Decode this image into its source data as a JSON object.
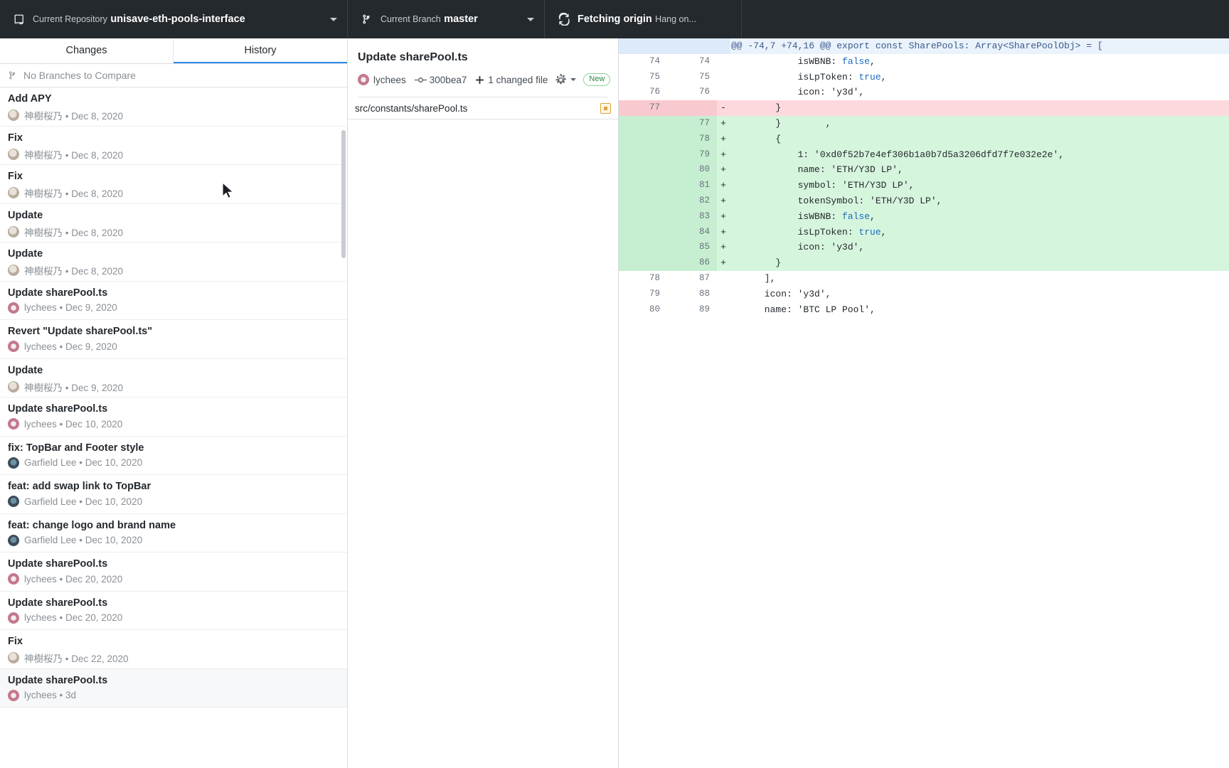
{
  "toolbar": {
    "repository": {
      "label": "Current Repository",
      "value": "unisave-eth-pools-interface",
      "icon": "repo-icon"
    },
    "branch": {
      "label": "Current Branch",
      "value": "master",
      "icon": "branch-icon"
    },
    "push": {
      "label": "Fetching origin",
      "value": "Hang on...",
      "icon": "sync-icon"
    }
  },
  "sidebar": {
    "tabs": [
      {
        "label": "Changes",
        "active": false
      },
      {
        "label": "History",
        "active": true
      }
    ],
    "compare": {
      "label": "No Branches to Compare",
      "icon": "branch-icon"
    },
    "commits": [
      {
        "title": "Update sharePool.ts",
        "author": "lychees",
        "date": "3d",
        "avatar": "av-lychees",
        "selected": true
      },
      {
        "title": "Fix",
        "author": "神樹桜乃",
        "date": "Dec 22, 2020",
        "avatar": "av-sakura",
        "selected": false
      },
      {
        "title": "Update sharePool.ts",
        "author": "lychees",
        "date": "Dec 20, 2020",
        "avatar": "av-lychees",
        "selected": false
      },
      {
        "title": "Update sharePool.ts",
        "author": "lychees",
        "date": "Dec 20, 2020",
        "avatar": "av-lychees",
        "selected": false
      },
      {
        "title": "feat: change logo and brand name",
        "author": "Garfield Lee",
        "date": "Dec 10, 2020",
        "avatar": "av-garfield",
        "selected": false
      },
      {
        "title": "feat: add swap link to TopBar",
        "author": "Garfield Lee",
        "date": "Dec 10, 2020",
        "avatar": "av-garfield",
        "selected": false
      },
      {
        "title": "fix: TopBar and Footer style",
        "author": "Garfield Lee",
        "date": "Dec 10, 2020",
        "avatar": "av-garfield",
        "selected": false
      },
      {
        "title": "Update sharePool.ts",
        "author": "lychees",
        "date": "Dec 10, 2020",
        "avatar": "av-lychees",
        "selected": false
      },
      {
        "title": "Update",
        "author": "神樹桜乃",
        "date": "Dec 9, 2020",
        "avatar": "av-sakura",
        "selected": false
      },
      {
        "title": "Revert \"Update sharePool.ts\"",
        "author": "lychees",
        "date": "Dec 9, 2020",
        "avatar": "av-lychees",
        "selected": false
      },
      {
        "title": "Update sharePool.ts",
        "author": "lychees",
        "date": "Dec 9, 2020",
        "avatar": "av-lychees",
        "selected": false
      },
      {
        "title": "Update",
        "author": "神樹桜乃",
        "date": "Dec 8, 2020",
        "avatar": "av-sakura",
        "selected": false
      },
      {
        "title": "Update",
        "author": "神樹桜乃",
        "date": "Dec 8, 2020",
        "avatar": "av-sakura",
        "selected": false
      },
      {
        "title": "Fix",
        "author": "神樹桜乃",
        "date": "Dec 8, 2020",
        "avatar": "av-sakura",
        "selected": false
      },
      {
        "title": "Fix",
        "author": "神樹桜乃",
        "date": "Dec 8, 2020",
        "avatar": "av-sakura",
        "selected": false
      },
      {
        "title": "Add APY",
        "author": "神樹桜乃",
        "date": "Dec 8, 2020",
        "avatar": "av-sakura",
        "selected": false
      }
    ]
  },
  "detail": {
    "title": "Update sharePool.ts",
    "author": "lychees",
    "author_avatar": "av-lychees",
    "sha": "300bea7",
    "changed_files": "1 changed file",
    "badge": "New",
    "file": {
      "path": "src/constants/sharePool.ts",
      "status": "modified"
    }
  },
  "diff": {
    "rows": [
      {
        "type": "hunk",
        "old": "",
        "new": "",
        "marker": "",
        "code": "@@ -74,7 +74,16 @@ export const SharePools: Array<SharePoolObj> = ["
      },
      {
        "type": "ctx",
        "old": "74",
        "new": "74",
        "marker": "",
        "code": "            isWBNB: false,"
      },
      {
        "type": "ctx",
        "old": "75",
        "new": "75",
        "marker": "",
        "code": "            isLpToken: true,"
      },
      {
        "type": "ctx",
        "old": "76",
        "new": "76",
        "marker": "",
        "code": "            icon: 'y3d',"
      },
      {
        "type": "del",
        "old": "77",
        "new": "",
        "marker": "-",
        "code": "        }"
      },
      {
        "type": "add",
        "old": "",
        "new": "77",
        "marker": "+",
        "code": "        }        ,"
      },
      {
        "type": "add",
        "old": "",
        "new": "78",
        "marker": "+",
        "code": "        {"
      },
      {
        "type": "add",
        "old": "",
        "new": "79",
        "marker": "+",
        "code": "            1: '0xd0f52b7e4ef306b1a0b7d5a3206dfd7f7e032e2e',"
      },
      {
        "type": "add",
        "old": "",
        "new": "80",
        "marker": "+",
        "code": "            name: 'ETH/Y3D LP',"
      },
      {
        "type": "add",
        "old": "",
        "new": "81",
        "marker": "+",
        "code": "            symbol: 'ETH/Y3D LP',"
      },
      {
        "type": "add",
        "old": "",
        "new": "82",
        "marker": "+",
        "code": "            tokenSymbol: 'ETH/Y3D LP',"
      },
      {
        "type": "add",
        "old": "",
        "new": "83",
        "marker": "+",
        "code": "            isWBNB: false,"
      },
      {
        "type": "add",
        "old": "",
        "new": "84",
        "marker": "+",
        "code": "            isLpToken: true,"
      },
      {
        "type": "add",
        "old": "",
        "new": "85",
        "marker": "+",
        "code": "            icon: 'y3d',"
      },
      {
        "type": "add",
        "old": "",
        "new": "86",
        "marker": "+",
        "code": "        }"
      },
      {
        "type": "ctx",
        "old": "78",
        "new": "87",
        "marker": "",
        "code": "      ],"
      },
      {
        "type": "ctx",
        "old": "79",
        "new": "88",
        "marker": "",
        "code": "      icon: 'y3d',"
      },
      {
        "type": "ctx",
        "old": "80",
        "new": "89",
        "marker": "",
        "code": "      name: 'BTC LP Pool',"
      }
    ],
    "keywords": [
      "false",
      "true"
    ]
  },
  "colors": {
    "toolbar_bg": "#24292e",
    "accent": "#2e8ae6",
    "add_bg": "#d6f5dd",
    "del_bg": "#fdd9dd",
    "hunk_bg": "#eaf2fb",
    "badge_green": "#2b8a3e"
  }
}
